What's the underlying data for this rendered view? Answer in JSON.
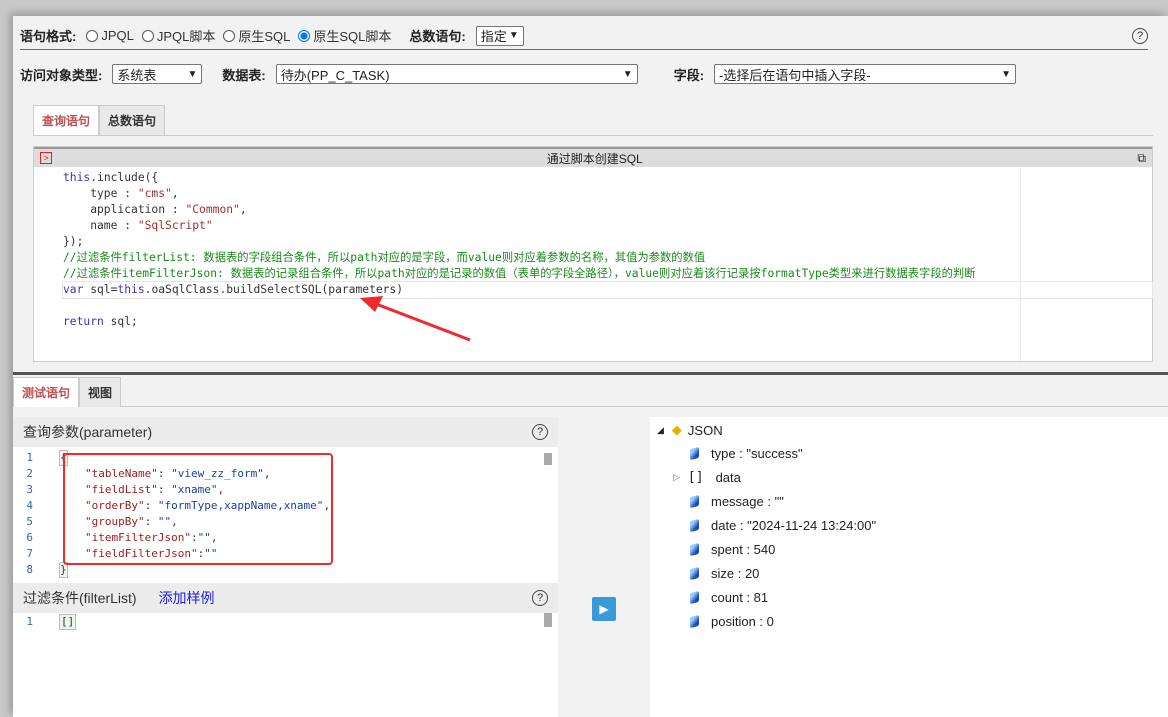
{
  "toolbar": {
    "format_label": "语句格式:",
    "formats": [
      "JPQL",
      "JPQL脚本",
      "原生SQL",
      "原生SQL脚本"
    ],
    "selected_format": "原生SQL脚本",
    "count_label": "总数语句:",
    "count_value": "指定",
    "access_label": "访问对象类型:",
    "access_value": "系统表",
    "table_label": "数据表:",
    "table_value": "待办(PP_C_TASK)",
    "field_label": "字段:",
    "field_value": "-选择后在语句中插入字段-"
  },
  "tabs": [
    "查询语句",
    "总数语句"
  ],
  "editor": {
    "title": "通过脚本创建SQL",
    "lines": [
      [
        "this",
        ".include({"
      ],
      [
        "    type : ",
        "\"cms\"",
        ","
      ],
      [
        "    application : ",
        "\"Common\"",
        ","
      ],
      [
        "    name : ",
        "\"SqlScript\""
      ],
      [
        "});"
      ],
      [
        "//过滤条件filterList: 数据表的字段组合条件，所以path对应的是字段，而value则对应着参数的名称，其值为参数的数值"
      ],
      [
        "//过滤条件itemFilterJson: 数据表的记录组合条件，所以path对应的是记录的数值（表单的字段全路径），value则对应着该行记录按formatType类型来进行数据表字段的判断"
      ],
      [
        "var",
        " sql=",
        "this",
        ".oaSqlClass.buildSelectSQL(parameters)"
      ],
      [
        ""
      ],
      [
        "return",
        " sql;"
      ]
    ]
  },
  "bottom_tabs": [
    "测试语句",
    "视图"
  ],
  "parameter": {
    "title": "查询参数(parameter)",
    "lines": [
      {
        "n": "1",
        "t": "{"
      },
      {
        "n": "2",
        "k": "\"tableName\"",
        "v": "\"view_zz_form\"",
        "e": ","
      },
      {
        "n": "3",
        "k": "\"fieldList\"",
        "v": "\"xname\"",
        "e": ","
      },
      {
        "n": "4",
        "k": "\"orderBy\"",
        "v": "\"formType,xappName,xname\"",
        "e": ","
      },
      {
        "n": "5",
        "k": "\"groupBy\"",
        "v": "\"\"",
        "e": ","
      },
      {
        "n": "6",
        "k": "\"itemFilterJson\"",
        "v": "\"\"",
        "e": ",",
        "tight": true
      },
      {
        "n": "7",
        "k": "\"fieldFilterJson\"",
        "v": "\"\"",
        "tight": true
      },
      {
        "n": "8",
        "t": "}"
      }
    ]
  },
  "filter": {
    "title": "过滤条件(filterList)",
    "add_sample": "添加样例",
    "line_no": "1",
    "content": "[]"
  },
  "result": {
    "root": "JSON",
    "items": [
      "type : \"success\"",
      "data",
      "message : \"\"",
      "date : \"2024-11-24 13:24:00\"",
      "spent : 540",
      "size : 20",
      "count : 81",
      "position : 0"
    ],
    "array_marker": "[]"
  }
}
